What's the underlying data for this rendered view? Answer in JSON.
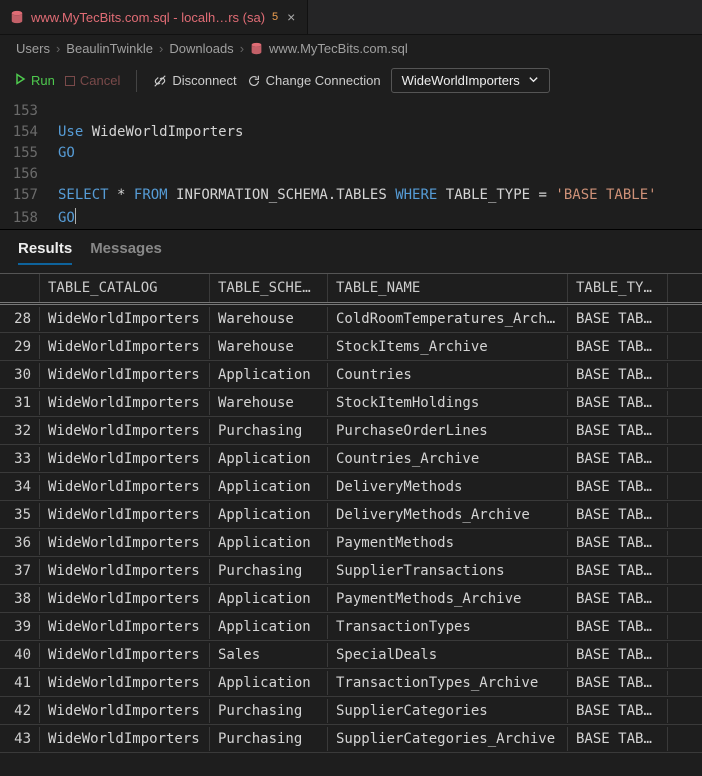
{
  "tab": {
    "title": "www.MyTecBits.com.sql - localh…rs (sa)",
    "dirty_badge": "5"
  },
  "breadcrumbs": {
    "items": [
      "Users",
      "BeaulinTwinkle",
      "Downloads",
      "www.MyTecBits.com.sql"
    ]
  },
  "toolbar": {
    "run": "Run",
    "cancel": "Cancel",
    "disconnect": "Disconnect",
    "change_conn": "Change Connection",
    "db": "WideWorldImporters"
  },
  "editor": {
    "lines": [
      {
        "num": "153",
        "tokens": []
      },
      {
        "num": "154",
        "tokens": [
          [
            "kw",
            "Use"
          ],
          [
            "sp",
            " "
          ],
          [
            "id",
            "WideWorldImporters"
          ]
        ]
      },
      {
        "num": "155",
        "tokens": [
          [
            "kw",
            "GO"
          ]
        ]
      },
      {
        "num": "156",
        "tokens": []
      },
      {
        "num": "157",
        "tokens": [
          [
            "kw",
            "SELECT"
          ],
          [
            "sp",
            " "
          ],
          [
            "op",
            "*"
          ],
          [
            "sp",
            " "
          ],
          [
            "kw",
            "FROM"
          ],
          [
            "sp",
            " "
          ],
          [
            "id",
            "INFORMATION_SCHEMA.TABLES"
          ],
          [
            "sp",
            " "
          ],
          [
            "kw",
            "WHERE"
          ],
          [
            "sp",
            " "
          ],
          [
            "id",
            "TABLE_TYPE"
          ],
          [
            "sp",
            " "
          ],
          [
            "op",
            "="
          ],
          [
            "sp",
            " "
          ],
          [
            "str",
            "'BASE TABLE'"
          ]
        ]
      },
      {
        "num": "158",
        "tokens": [
          [
            "kw",
            "GO"
          ],
          [
            "cursor",
            ""
          ]
        ]
      }
    ]
  },
  "results": {
    "tabs": {
      "results": "Results",
      "messages": "Messages"
    },
    "headers": {
      "rownum": "",
      "catalog": "TABLE_CATALOG",
      "schema": "TABLE_SCHEMA",
      "name": "TABLE_NAME",
      "type": "TABLE_TYPE"
    },
    "rows": [
      {
        "n": "28",
        "cat": "WideWorldImporters",
        "sch": "Warehouse",
        "name": "ColdRoomTemperatures_Arch…",
        "type": "BASE TABLE"
      },
      {
        "n": "29",
        "cat": "WideWorldImporters",
        "sch": "Warehouse",
        "name": "StockItems_Archive",
        "type": "BASE TABLE"
      },
      {
        "n": "30",
        "cat": "WideWorldImporters",
        "sch": "Application",
        "name": "Countries",
        "type": "BASE TABLE"
      },
      {
        "n": "31",
        "cat": "WideWorldImporters",
        "sch": "Warehouse",
        "name": "StockItemHoldings",
        "type": "BASE TABLE"
      },
      {
        "n": "32",
        "cat": "WideWorldImporters",
        "sch": "Purchasing",
        "name": "PurchaseOrderLines",
        "type": "BASE TABLE"
      },
      {
        "n": "33",
        "cat": "WideWorldImporters",
        "sch": "Application",
        "name": "Countries_Archive",
        "type": "BASE TABLE"
      },
      {
        "n": "34",
        "cat": "WideWorldImporters",
        "sch": "Application",
        "name": "DeliveryMethods",
        "type": "BASE TABLE"
      },
      {
        "n": "35",
        "cat": "WideWorldImporters",
        "sch": "Application",
        "name": "DeliveryMethods_Archive",
        "type": "BASE TABLE"
      },
      {
        "n": "36",
        "cat": "WideWorldImporters",
        "sch": "Application",
        "name": "PaymentMethods",
        "type": "BASE TABLE"
      },
      {
        "n": "37",
        "cat": "WideWorldImporters",
        "sch": "Purchasing",
        "name": "SupplierTransactions",
        "type": "BASE TABLE"
      },
      {
        "n": "38",
        "cat": "WideWorldImporters",
        "sch": "Application",
        "name": "PaymentMethods_Archive",
        "type": "BASE TABLE"
      },
      {
        "n": "39",
        "cat": "WideWorldImporters",
        "sch": "Application",
        "name": "TransactionTypes",
        "type": "BASE TABLE"
      },
      {
        "n": "40",
        "cat": "WideWorldImporters",
        "sch": "Sales",
        "name": "SpecialDeals",
        "type": "BASE TABLE"
      },
      {
        "n": "41",
        "cat": "WideWorldImporters",
        "sch": "Application",
        "name": "TransactionTypes_Archive",
        "type": "BASE TABLE"
      },
      {
        "n": "42",
        "cat": "WideWorldImporters",
        "sch": "Purchasing",
        "name": "SupplierCategories",
        "type": "BASE TABLE"
      },
      {
        "n": "43",
        "cat": "WideWorldImporters",
        "sch": "Purchasing",
        "name": "SupplierCategories_Archive",
        "type": "BASE TABLE"
      }
    ]
  }
}
